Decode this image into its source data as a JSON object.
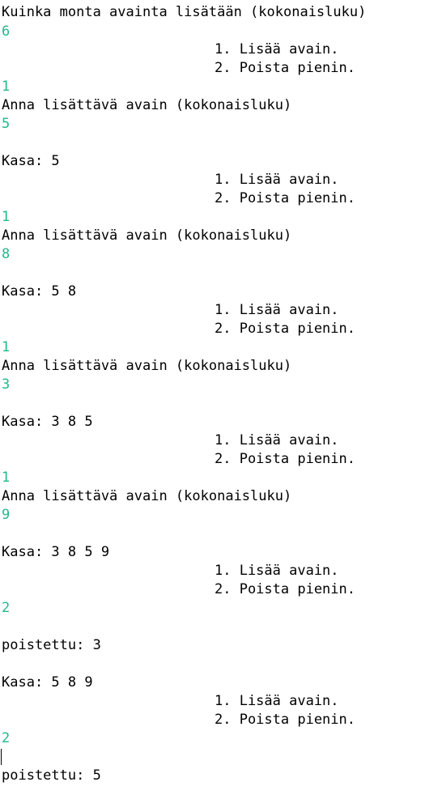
{
  "console": {
    "lines": [
      {
        "text": "Kuinka monta avainta lisätään (kokonaisluku)",
        "kind": "output"
      },
      {
        "text": "6",
        "kind": "input"
      },
      {
        "text": "1. Lisää avain.",
        "kind": "menu"
      },
      {
        "text": "2. Poista pienin.",
        "kind": "menu"
      },
      {
        "text": "1",
        "kind": "input"
      },
      {
        "text": "Anna lisättävä avain (kokonaisluku)",
        "kind": "output"
      },
      {
        "text": "5",
        "kind": "input"
      },
      {
        "text": "Kasa: 5",
        "kind": "output"
      },
      {
        "text": "1. Lisää avain.",
        "kind": "menu"
      },
      {
        "text": "2. Poista pienin.",
        "kind": "menu"
      },
      {
        "text": "1",
        "kind": "input"
      },
      {
        "text": "Anna lisättävä avain (kokonaisluku)",
        "kind": "output"
      },
      {
        "text": "8",
        "kind": "input"
      },
      {
        "text": "Kasa: 5 8",
        "kind": "output"
      },
      {
        "text": "1. Lisää avain.",
        "kind": "menu"
      },
      {
        "text": "2. Poista pienin.",
        "kind": "menu"
      },
      {
        "text": "1",
        "kind": "input"
      },
      {
        "text": "Anna lisättävä avain (kokonaisluku)",
        "kind": "output"
      },
      {
        "text": "3",
        "kind": "input"
      },
      {
        "text": "Kasa: 3 8 5",
        "kind": "output"
      },
      {
        "text": "1. Lisää avain.",
        "kind": "menu"
      },
      {
        "text": "2. Poista pienin.",
        "kind": "menu"
      },
      {
        "text": "1",
        "kind": "input"
      },
      {
        "text": "Anna lisättävä avain (kokonaisluku)",
        "kind": "output"
      },
      {
        "text": "9",
        "kind": "input"
      },
      {
        "text": "Kasa: 3 8 5 9",
        "kind": "output"
      },
      {
        "text": "1. Lisää avain.",
        "kind": "menu"
      },
      {
        "text": "2. Poista pienin.",
        "kind": "menu"
      },
      {
        "text": "2",
        "kind": "input"
      },
      {
        "text": "poistettu: 3",
        "kind": "output"
      },
      {
        "text": "Kasa: 5 8 9",
        "kind": "output"
      },
      {
        "text": "1. Lisää avain.",
        "kind": "menu"
      },
      {
        "text": "2. Poista pienin.",
        "kind": "menu"
      },
      {
        "text": "2",
        "kind": "input"
      },
      {
        "text": "poistettu: 5",
        "kind": "output"
      }
    ]
  },
  "colors": {
    "background": "#ffffff",
    "text": "#000000",
    "user_input": "#1fba8c"
  }
}
